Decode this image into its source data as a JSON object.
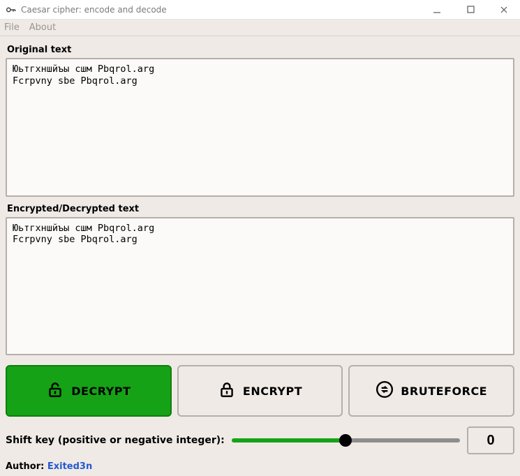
{
  "window": {
    "title": "Caesar cipher: encode and decode"
  },
  "menu": {
    "file": "File",
    "about": "About"
  },
  "labels": {
    "original": "Original text",
    "result": "Encrypted/Decrypted text",
    "shift": "Shift key (positive or negative integer):",
    "author_prefix": "Author: "
  },
  "text": {
    "original": "Юьтгхншйъы сшм Pbqrol.arg\nFcrpvny sbe Pbqrol.arg",
    "result": "Юьтгхншйъы сшм Pbqrol.arg\nFcrpvny sbe Pbqrol.arg"
  },
  "buttons": {
    "decrypt": "DECRYPT",
    "encrypt": "ENCRYPT",
    "bruteforce": "BRUTEFORCE"
  },
  "shift": {
    "value": "0",
    "percent": 50
  },
  "author": {
    "name": "Exited3n"
  }
}
